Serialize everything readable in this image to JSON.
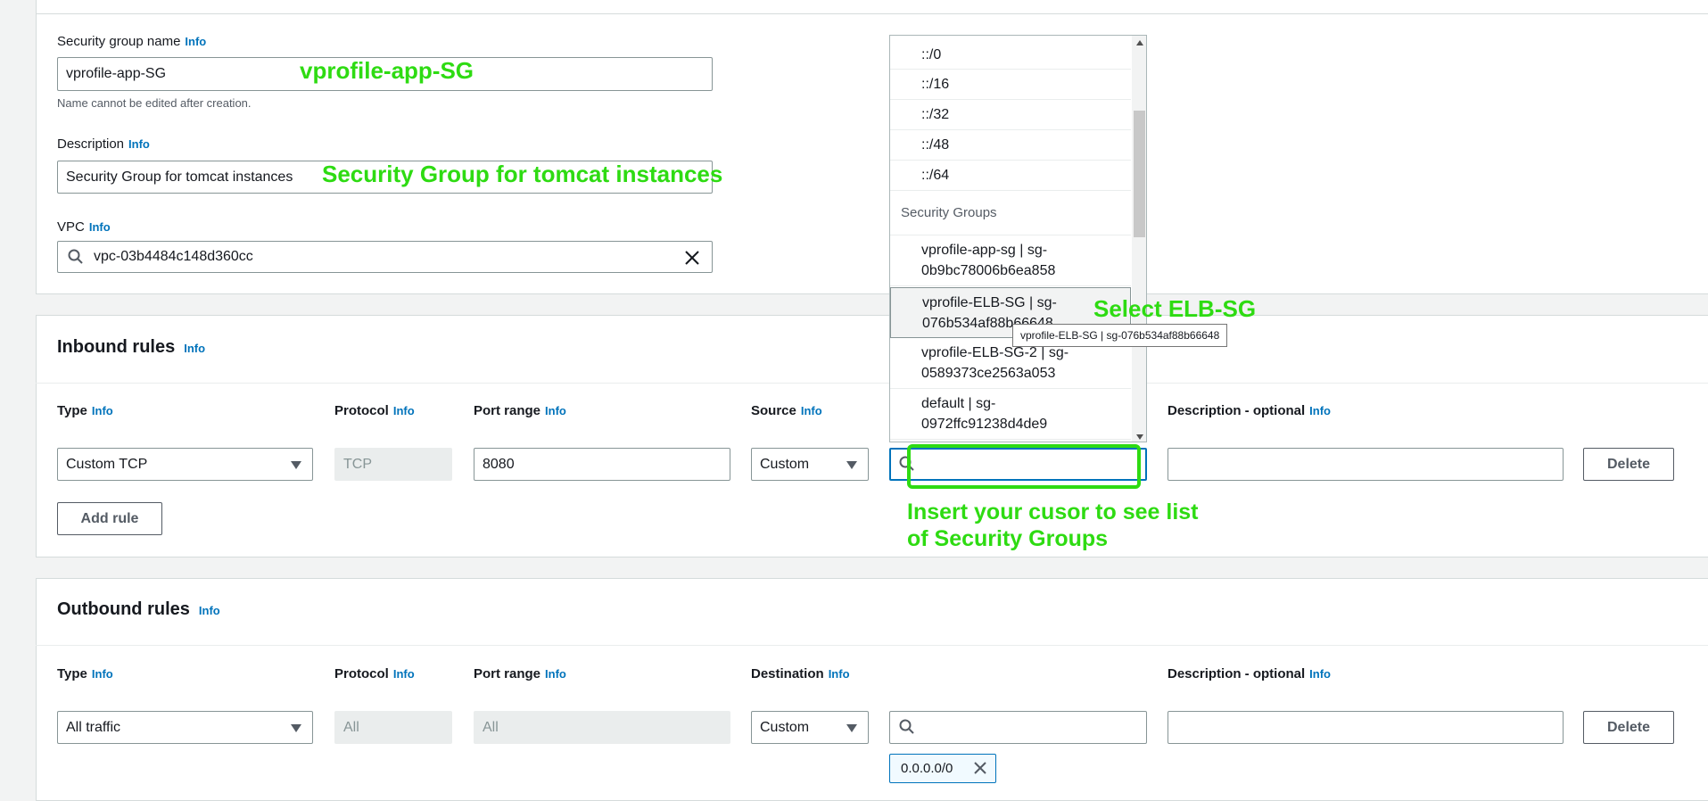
{
  "basic": {
    "name_label": "Security group name",
    "name_info": "Info",
    "name_value": "vprofile-app-SG",
    "name_hint": "Name cannot be edited after creation.",
    "desc_label": "Description",
    "desc_info": "Info",
    "desc_value": "Security Group for tomcat instances",
    "vpc_label": "VPC",
    "vpc_info": "Info",
    "vpc_value": "vpc-03b4484c148d360cc"
  },
  "inbound": {
    "title": "Inbound rules",
    "info": "Info",
    "col_type": "Type",
    "col_type_info": "Info",
    "col_protocol": "Protocol",
    "col_protocol_info": "Info",
    "col_port": "Port range",
    "col_port_info": "Info",
    "col_source": "Source",
    "col_source_info": "Info",
    "col_desc": "Description - optional",
    "col_desc_info": "Info",
    "row": {
      "type": "Custom TCP",
      "protocol": "TCP",
      "port": "8080",
      "source": "Custom",
      "search": ""
    },
    "delete_label": "Delete",
    "add_rule_label": "Add rule"
  },
  "dropdown": {
    "cidrs": [
      "::/0",
      "::/16",
      "::/32",
      "::/48",
      "::/64"
    ],
    "group_header": "Security Groups",
    "groups": [
      {
        "line1": "vprofile-app-sg | sg-",
        "line2": "0b9bc78006b6ea858"
      },
      {
        "line1": "vprofile-ELB-SG | sg-",
        "line2": "076b534af88b66648"
      },
      {
        "line1": "vprofile-ELB-SG-2 | sg-",
        "line2": "0589373ce2563a053"
      },
      {
        "line1": "default | sg-",
        "line2": "0972ffc91238d4de9"
      }
    ],
    "tooltip": "vprofile-ELB-SG | sg-076b534af88b66648"
  },
  "outbound": {
    "title": "Outbound rules",
    "info": "Info",
    "col_type": "Type",
    "col_type_info": "Info",
    "col_protocol": "Protocol",
    "col_protocol_info": "Info",
    "col_port": "Port range",
    "col_port_info": "Info",
    "col_dest": "Destination",
    "col_dest_info": "Info",
    "col_desc": "Description - optional",
    "col_desc_info": "Info",
    "row": {
      "type": "All traffic",
      "protocol": "All",
      "port": "All",
      "dest": "Custom",
      "token": "0.0.0.0/0"
    },
    "delete_label": "Delete"
  },
  "annotations": {
    "name": "vprofile-app-SG",
    "desc": "Security Group for tomcat instances",
    "select": "Select ELB-SG",
    "insert_line1": "Insert your cusor to see list",
    "insert_line2": "of Security Groups",
    "color": "#2edb12"
  }
}
